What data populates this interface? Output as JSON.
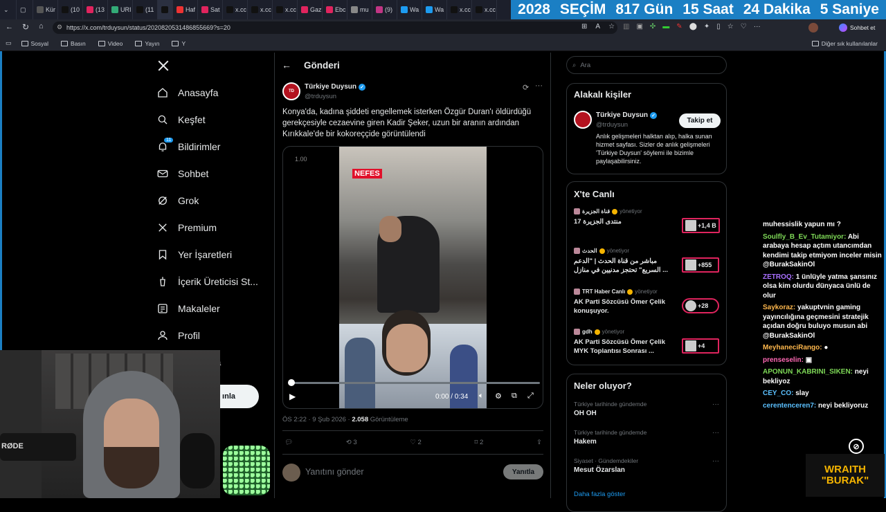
{
  "browser": {
    "tabs": [
      {
        "label": "Kür",
        "color": "#555"
      },
      {
        "label": "(10",
        "color": "#111"
      },
      {
        "label": "(13",
        "color": "#e0245e"
      },
      {
        "label": "URI",
        "color": "#3a7"
      },
      {
        "label": "(11",
        "color": "#111"
      },
      {
        "label": "",
        "color": "#111"
      },
      {
        "label": "Haf",
        "color": "#e33"
      },
      {
        "label": "Sat",
        "color": "#e0245e"
      },
      {
        "label": "x.cc",
        "color": "#111"
      },
      {
        "label": "x.cc",
        "color": "#111"
      },
      {
        "label": "x.cc",
        "color": "#111"
      },
      {
        "label": "Gaz",
        "color": "#e0245e"
      },
      {
        "label": "Ebc",
        "color": "#e0245e"
      },
      {
        "label": "mu",
        "color": "#888"
      },
      {
        "label": "(9)",
        "color": "#c13584"
      },
      {
        "label": "Wa",
        "color": "#1d9bf0"
      },
      {
        "label": "Wa",
        "color": "#1d9bf0"
      },
      {
        "label": "x.cc",
        "color": "#111"
      },
      {
        "label": "x.cc",
        "color": "#111"
      }
    ],
    "countdown": {
      "year": "2028",
      "event": "SEÇİM",
      "days": "817 Gün",
      "hours": "15 Saat",
      "minutes": "24 Dakika",
      "seconds": "5 Saniye"
    },
    "url": "https://x.com/trduysun/status/2020820531486855669?s=20",
    "chat_button": "Sohbet et",
    "bookmarks": [
      "Sosyal",
      "Basın",
      "Video",
      "Yayın",
      "Y"
    ],
    "other_bookmarks": "Diğer sık kullanılanlar"
  },
  "nav": {
    "logo": "X",
    "items": [
      {
        "label": "Anasayfa",
        "icon": "home-icon"
      },
      {
        "label": "Keşfet",
        "icon": "search-icon"
      },
      {
        "label": "Bildirimler",
        "icon": "bell-icon",
        "badge": "11"
      },
      {
        "label": "Sohbet",
        "icon": "mail-icon"
      },
      {
        "label": "Grok",
        "icon": "grok-icon"
      },
      {
        "label": "Premium",
        "icon": "x-icon"
      },
      {
        "label": "Yer İşaretleri",
        "icon": "bookmark-icon"
      },
      {
        "label": "İçerik Üreticisi St...",
        "icon": "creator-icon"
      },
      {
        "label": "Makaleler",
        "icon": "article-icon"
      },
      {
        "label": "Profil",
        "icon": "profile-icon"
      }
    ],
    "post_button_partial": "ınla",
    "more_partial": "a"
  },
  "post": {
    "header_title": "Gönderi",
    "author_name": "Türkiye Duysun",
    "author_handle": "@trduysun",
    "text": "Konya'da, kadına şiddeti engellemek isterken Özgür Duran'ı öldürdüğü gerekçesiyle cezaevine giren Kadir Şeker, uzun bir aranın ardından Kırıkkale'de bir kokoreççide görüntülendi",
    "video": {
      "speed": "1.00",
      "overlay": "NEFES",
      "time": "0:00 / 0:34",
      "progress": 0
    },
    "meta_time": "ÖS 2:22 · 9 Şub 2026 · ",
    "views": "2.058",
    "views_label": " Görüntüleme",
    "actions": {
      "reposts": "3",
      "likes": "2",
      "bookmarks": "2"
    },
    "reply_placeholder": "Yanıtını gönder",
    "reply_button": "Yanıtla"
  },
  "right": {
    "search_placeholder": "Ara",
    "related": {
      "title": "Alakalı kişiler",
      "name": "Türkiye Duysun",
      "handle": "@trduysun",
      "follow": "Takip et",
      "bio": "Anlık gelişmeleri halktan alıp, halka sunan hizmet sayfası. Sizler de anlık gelişmeleri 'Türkiye Duysun' söylemi ile bizimle paylaşabilirsiniz."
    },
    "live": {
      "title": "X'te Canlı",
      "items": [
        {
          "host": "قناة الجزيرة",
          "role": "yönetiyor",
          "title": "منتدى الجزيرة 17",
          "count": "+1,4 B"
        },
        {
          "host": "الحدث",
          "role": "yönetiyor",
          "title": "مباشر من قناة الحدث | \"الدعم السريع\" تحتجز مدنيين في منازل ...",
          "count": "+855"
        },
        {
          "host": "TRT Haber Canlı",
          "role": "yönetiyor",
          "title": "AK Parti Sözcüsü Ömer Çelik konuşuyor.",
          "count": "+28"
        },
        {
          "host": "gdh",
          "role": "yönetiyor",
          "title": "AK Parti Sözcüsü Ömer Çelik MYK Toplantısı Sonrası ...",
          "count": "+4"
        }
      ]
    },
    "trends": {
      "title": "Neler oluyor?",
      "items": [
        {
          "context": "Türkiye tarihinde gündemde",
          "name": "OH OH"
        },
        {
          "context": "Türkiye tarihinde gündemde",
          "name": "Hakem"
        },
        {
          "context": "Siyaset · Gündemdekiler",
          "name": "Mesut Özarslan"
        }
      ],
      "more": "Daha fazla göster"
    }
  },
  "chat": {
    "lines": [
      {
        "user": "",
        "msg": "muhessislik yapun mı ?",
        "color": "#ffffff"
      },
      {
        "user": "Soulfly_B_Ev_Tutamiyor:",
        "msg": " Abi arabaya hesap açtım utancımdan kendimi takip etmiyom inceler misin @BurakSakinOl",
        "color": "#7ed957"
      },
      {
        "user": "ZETROQ:",
        "msg": " 1 ünlüyle yatma şansınız olsa kim olurdu dünyaca ünlü de olur",
        "color": "#a970ff"
      },
      {
        "user": "Saykoraz:",
        "msg": " yakuptvnin gaming yayıncılığına geçmesini stratejik açıdan doğru buluyo musun abi @BurakSakinOl",
        "color": "#ffb84d"
      },
      {
        "user": "MeyhaneciRango:",
        "msg": " ●",
        "color": "#ffb84d"
      },
      {
        "user": "prenseselin:",
        "msg": " ▣",
        "color": "#ff69b4"
      },
      {
        "user": "APONUN_KABRINI_SIKEN:",
        "msg": " neyi bekliyoz",
        "color": "#7ed957"
      },
      {
        "user": "CEY_CO:",
        "msg": " slay",
        "color": "#5bc0ff"
      },
      {
        "user": "cerentenceren7:",
        "msg": " neyi bekliyoruz",
        "color": "#5bc0ff"
      }
    ]
  },
  "stream": {
    "overlay_line1": "WRAITH",
    "overlay_line2": "\"BURAK\"",
    "mic_label": "RØDE"
  }
}
